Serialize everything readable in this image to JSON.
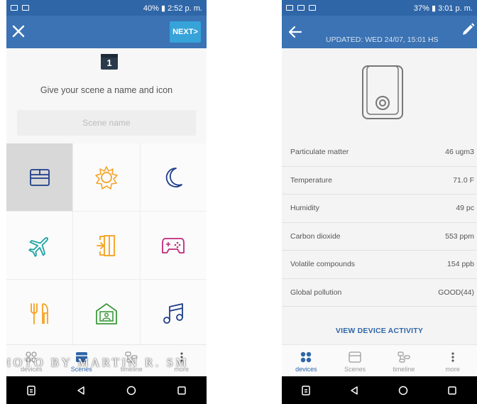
{
  "left": {
    "status": {
      "time_battery": "40% ▮ 2:52 p. m."
    },
    "header": {
      "next_label": "NEXT>"
    },
    "step_number": "1",
    "prompt": "Give your scene a name and icon",
    "scene_name_placeholder": "Scene name",
    "icons": [
      "window-icon",
      "sun-icon",
      "moon-icon",
      "airplane-icon",
      "door-icon",
      "gamepad-icon",
      "cutlery-icon",
      "house-person-icon",
      "music-icon"
    ],
    "nav": [
      {
        "label": "devices",
        "icon": "devices-icon",
        "active": false
      },
      {
        "label": "Scenes",
        "icon": "scenes-icon",
        "active": true
      },
      {
        "label": "timeline",
        "icon": "timeline-icon",
        "active": false
      },
      {
        "label": "more",
        "icon": "more-icon",
        "active": false
      }
    ],
    "watermark": "HOTO BY MARTIN R. SM"
  },
  "right": {
    "status": {
      "time_battery": "37% ▮ 3:01 p. m."
    },
    "header": {
      "updated": "UPDATED: WED 24/07, 15:01 HS"
    },
    "readings": [
      {
        "label": "Particulate matter",
        "value": "46 ugm3"
      },
      {
        "label": "Temperature",
        "value": "71.0 F"
      },
      {
        "label": "Humidity",
        "value": "49 pc"
      },
      {
        "label": "Carbon dioxide",
        "value": "553 ppm"
      },
      {
        "label": "Volatile compounds",
        "value": "154 ppb"
      },
      {
        "label": "Global pollution",
        "value": "GOOD(44)"
      }
    ],
    "activity_link": "VIEW DEVICE ACTIVITY",
    "nav": [
      {
        "label": "devices",
        "icon": "devices-icon",
        "active": true
      },
      {
        "label": "Scenes",
        "icon": "scenes-icon",
        "active": false
      },
      {
        "label": "timeline",
        "icon": "timeline-icon",
        "active": false
      },
      {
        "label": "more",
        "icon": "more-icon",
        "active": false
      }
    ]
  },
  "colors": {
    "status_bar": "#2f66a8",
    "app_bar": "#3b73b4",
    "accent": "#36a3d9",
    "icon_orange": "#f5a01f",
    "icon_navy": "#1f3d8a",
    "icon_teal": "#1fa3a3",
    "icon_magenta": "#c0297a",
    "icon_green": "#3c9a3c"
  }
}
